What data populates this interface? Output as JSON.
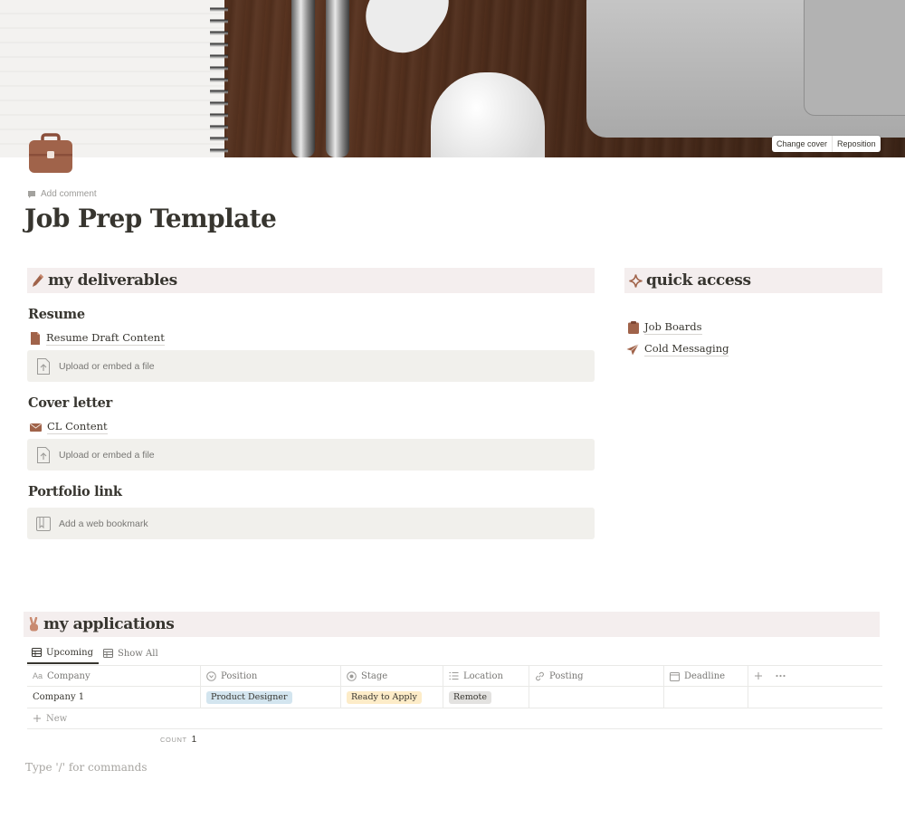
{
  "cover": {
    "change_cover": "Change cover",
    "reposition": "Reposition"
  },
  "page": {
    "icon": "briefcase-icon",
    "add_comment": "Add comment",
    "title": "Job Prep Template",
    "placeholder": "Type '/' for commands"
  },
  "deliverables": {
    "heading": "my deliverables",
    "icon": "pencil-icon",
    "resume": {
      "heading": "Resume",
      "link": "Resume Draft Content",
      "embed": "Upload or embed a file"
    },
    "cover_letter": {
      "heading": "Cover letter",
      "link": "CL Content",
      "embed": "Upload or embed a file"
    },
    "portfolio": {
      "heading": "Portfolio link",
      "embed": "Add a web bookmark"
    }
  },
  "quick_access": {
    "heading": "quick access",
    "icon": "sparkle-icon",
    "links": [
      {
        "label": "Job Boards",
        "icon": "clipboard-icon"
      },
      {
        "label": "Cold Messaging",
        "icon": "paper-plane-icon"
      }
    ]
  },
  "applications": {
    "heading": "my applications",
    "icon": "victory-hand-icon",
    "tabs": [
      "Upcoming",
      "Show All"
    ],
    "columns": [
      "Company",
      "Position",
      "Stage",
      "Location",
      "Posting",
      "Deadline"
    ],
    "rows": [
      {
        "company": "Company 1",
        "position": "Product Designer",
        "stage": "Ready to Apply",
        "location": "Remote",
        "posting": "",
        "deadline": ""
      }
    ],
    "tag_colors": {
      "position": "#d3e5ef",
      "stage": "#fdecc8",
      "location": "#e3e2e0"
    },
    "new_label": "New",
    "count_label": "COUNT",
    "count_value": "1"
  },
  "colors": {
    "accent_brown": "#a0634a",
    "heading_bg": "#f4eeee",
    "embed_bg": "#f1f0ec",
    "text": "#37352f"
  }
}
